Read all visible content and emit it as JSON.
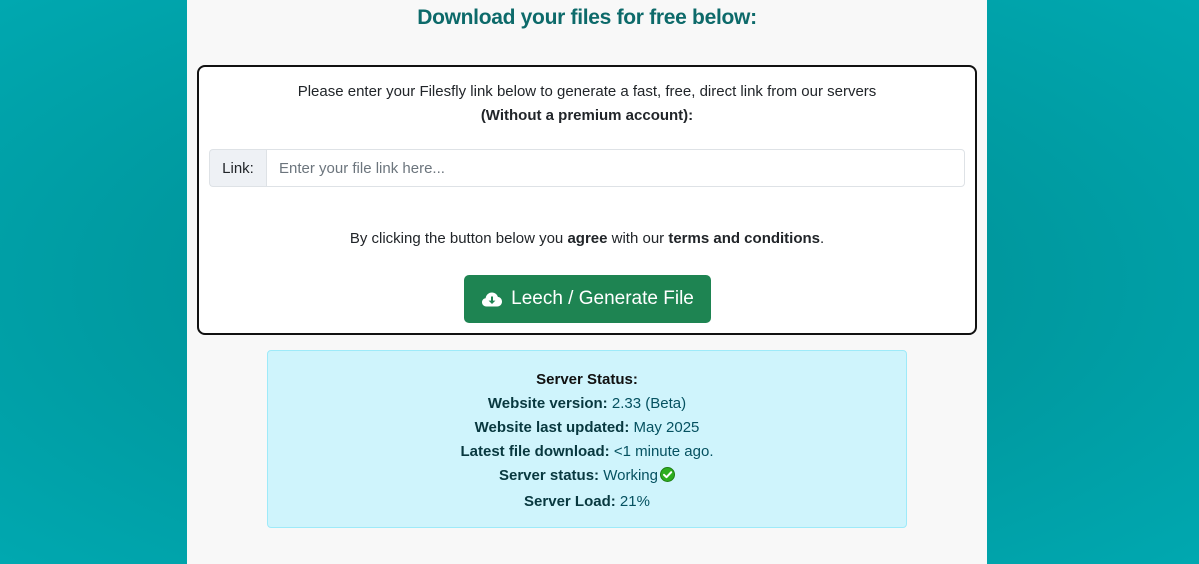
{
  "page": {
    "heading": "Download your files for free below:"
  },
  "form": {
    "intro_line1": "Please enter your Filesfly link below to generate a fast, free, direct link from our servers",
    "intro_line2": "(Without a premium account):",
    "link_label": "Link:",
    "link_value": "",
    "link_placeholder": "Enter your file link here...",
    "agree_pre": "By clicking the button below you ",
    "agree_bold": "agree",
    "agree_mid": " with our ",
    "agree_terms": "terms and conditions",
    "agree_post": ".",
    "button_label": "Leech / Generate File",
    "button_icon": "cloud-download-icon"
  },
  "status": {
    "title": "Server Status:",
    "version_label": "Website version:",
    "version_value": "2.33 (Beta)",
    "updated_label": "Website last updated:",
    "updated_value": "May 2025",
    "latest_label": "Latest file download:",
    "latest_value": "<1 minute ago.",
    "server_label": "Server status:",
    "server_value": "Working",
    "server_icon": "check-circle-icon",
    "load_label": "Server Load:",
    "load_value": "21%"
  },
  "colors": {
    "background": "#00969c",
    "heading": "#0d6a6a",
    "button": "#1e8452",
    "status_bg": "#cff4fc",
    "status_text": "#055160",
    "ok_green": "#2eae1f"
  }
}
